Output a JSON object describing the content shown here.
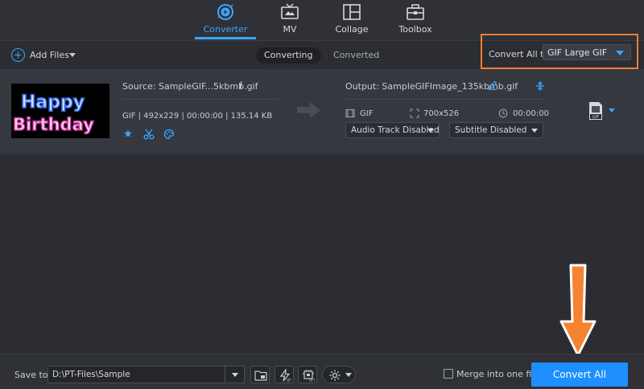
{
  "nav": {
    "tabs": [
      {
        "label": "Converter",
        "icon": "converter-icon",
        "active": true
      },
      {
        "label": "MV",
        "icon": "tv-icon",
        "active": false
      },
      {
        "label": "Collage",
        "icon": "collage-icon",
        "active": false
      },
      {
        "label": "Toolbox",
        "icon": "toolbox-icon",
        "active": false
      }
    ]
  },
  "toolbar": {
    "add_files_label": "Add Files",
    "segments": {
      "converting": "Converting",
      "converted": "Converted"
    },
    "convert_all_to_label": "Convert All to:",
    "convert_all_to_value": "GIF Large GIF"
  },
  "file": {
    "thumbnail_text_line1": "Happy",
    "thumbnail_text_line2": "Birthday",
    "source_name": "Source: SampleGIF...5kbmb.gif",
    "info_icon": "i",
    "source_meta": "GIF | 492x229 | 00:00:00 | 135.14 KB",
    "output_name": "Output: SampleGIFImage_135kbmb.gif",
    "output_format": "GIF",
    "output_resolution": "700x526",
    "output_duration": "00:00:00",
    "audio_track": "Audio Track Disabled",
    "subtitle": "Subtitle Disabled"
  },
  "bottom": {
    "save_to_label": "Save to:",
    "save_path": "D:\\PT-Files\\Sample",
    "merge_label": "Merge into one file",
    "merge_checked": false,
    "convert_all_label": "Convert All"
  },
  "colors": {
    "accent": "#3aa5ff",
    "highlight": "#f07f2f",
    "primary_button": "#1e8fff"
  }
}
